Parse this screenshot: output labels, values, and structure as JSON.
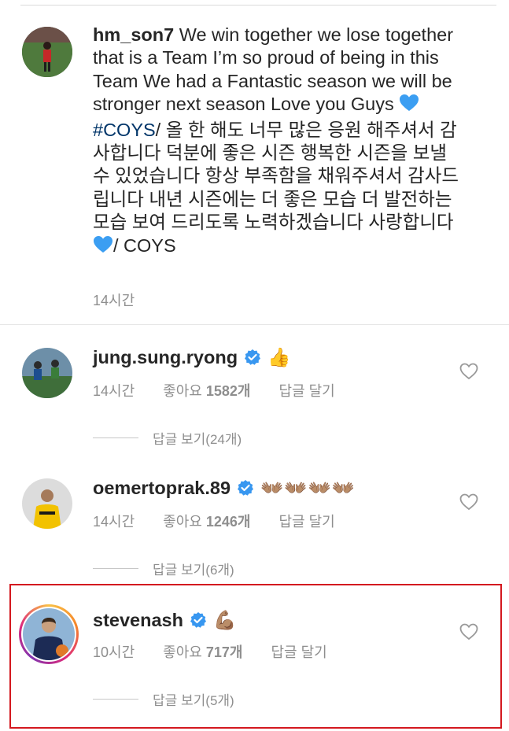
{
  "post": {
    "username": "hm_son7",
    "caption_a": " We win together we lose together that is a Team I’m so proud of being in this Team We had a Fantastic season we will be stronger next season Love you Guys ",
    "hashtag": "#COYS",
    "caption_b": "/ 올 한 해도 너무 많은 응원 해주셔서 감사합니다 덕분에 좋은 시즌 행복한 시즌을 보낼수 있었습니다 항상 부족함을 채워주셔서 감사드립니다 내년 시즌에는 더 좋은 모습 더 발전하는 모습 보여 드리도록 노력하겠습니다 사랑합니다 ",
    "caption_c": "/ COYS",
    "time": "14시간"
  },
  "comments": [
    {
      "username": "jung.sung.ryong",
      "emoji": "👍",
      "time": "14시간",
      "likes_label": "좋아요",
      "likes_count": "1582개",
      "reply": "답글 달기",
      "view_replies": "답글 보기(24개)"
    },
    {
      "username": "oemertoprak.89",
      "emoji": "👐🏽👐🏽👐🏽👐🏽",
      "time": "14시간",
      "likes_label": "좋아요",
      "likes_count": "1246개",
      "reply": "답글 달기",
      "view_replies": "답글 보기(6개)"
    },
    {
      "username": "stevenash",
      "emoji": "💪🏽",
      "time": "10시간",
      "likes_label": "좋아요",
      "likes_count": "717개",
      "reply": "답글 달기",
      "view_replies": "답글 보기(5개)"
    }
  ],
  "colors": {
    "text": "#262626",
    "secondary": "#8e8e8e",
    "hashtag": "#003569",
    "verified": "#3897f0",
    "highlight_border": "#d4181f"
  },
  "icons": [
    "blue-heart-icon",
    "verified-badge-icon",
    "like-heart-icon"
  ]
}
